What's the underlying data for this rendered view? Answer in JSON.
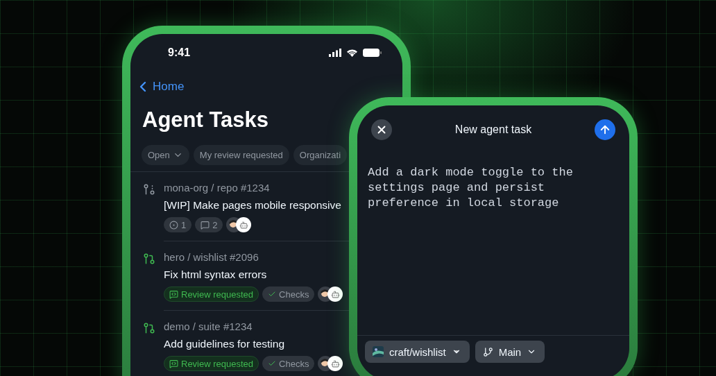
{
  "status_bar": {
    "time": "9:41"
  },
  "tasks_screen": {
    "back": "Home",
    "title": "Agent Tasks",
    "filters": [
      {
        "label": "Open",
        "dropdown": true
      },
      {
        "label": "My review requested",
        "dropdown": false
      },
      {
        "label": "Organizati",
        "dropdown": false
      }
    ],
    "tasks": [
      {
        "kind": "draft",
        "repo": "mona-org / repo #1234",
        "title": "[WIP] Make pages mobile responsive",
        "badges": [
          {
            "kind": "issues",
            "label": "1"
          },
          {
            "kind": "comments",
            "label": "2"
          }
        ]
      },
      {
        "kind": "pull",
        "repo": "hero / wishlist #2096",
        "title": "Fix html syntax errors",
        "badges": [
          {
            "kind": "review",
            "label": "Review requested"
          },
          {
            "kind": "checks",
            "label": "Checks"
          }
        ]
      },
      {
        "kind": "pull",
        "repo": "demo / suite #1234",
        "title": "Add guidelines for testing",
        "badges": [
          {
            "kind": "review",
            "label": "Review requested"
          },
          {
            "kind": "checks",
            "label": "Checks"
          }
        ]
      }
    ]
  },
  "new_task": {
    "title": "New agent task",
    "prompt": "Add a dark mode toggle to the settings page and persist preference in local storage",
    "repository": "craft/wishlist",
    "branch": "Main"
  }
}
